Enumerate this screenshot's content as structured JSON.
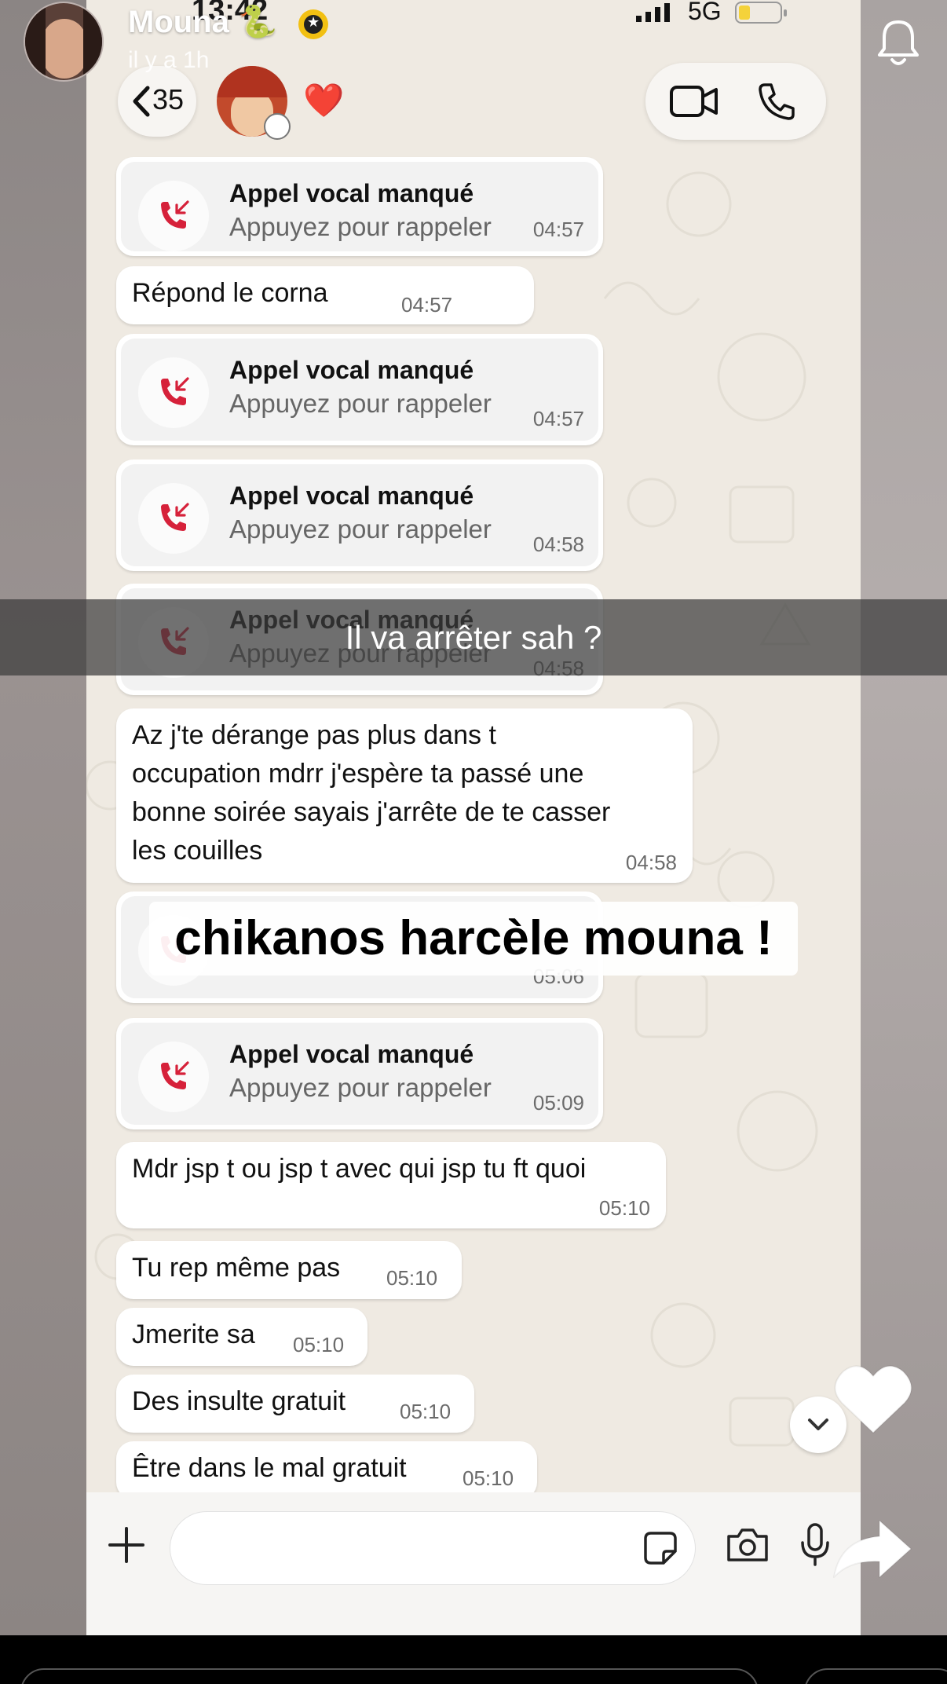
{
  "status_bar": {
    "time": "13:42",
    "network": "5G"
  },
  "story": {
    "user_name": "Mouna",
    "name_emoji": "🐍",
    "time_ago": "il y a 1h"
  },
  "chat_header": {
    "back_count": "35",
    "reaction_emoji": "❤️"
  },
  "messages": [
    {
      "type": "call",
      "title": "Appel vocal manqué",
      "subtitle": "Appuyez pour rappeler",
      "time": "04:57"
    },
    {
      "type": "text",
      "lines": [
        "Répond le corna"
      ],
      "time": "04:57"
    },
    {
      "type": "call",
      "title": "Appel vocal manqué",
      "subtitle": "Appuyez pour rappeler",
      "time": "04:57"
    },
    {
      "type": "call",
      "title": "Appel vocal manqué",
      "subtitle": "Appuyez pour rappeler",
      "time": "04:58"
    },
    {
      "type": "call",
      "title": "Appel vocal manqué",
      "subtitle": "Appuyez pour rappeler",
      "time": "04:58"
    },
    {
      "type": "text",
      "lines": [
        "Az j'te dérange pas plus dans t",
        "occupation mdrr j'espère ta passé une",
        "bonne soirée sayais j'arrête de te casser",
        "les couilles"
      ],
      "time": "04:58"
    },
    {
      "type": "call",
      "title": "",
      "subtitle": "",
      "time": "05:06"
    },
    {
      "type": "call",
      "title": "Appel vocal manqué",
      "subtitle": "Appuyez pour rappeler",
      "time": "05:09"
    },
    {
      "type": "text",
      "lines": [
        "Mdr jsp t ou jsp t avec qui jsp tu ft quoi"
      ],
      "time": "05:10"
    },
    {
      "type": "text",
      "lines": [
        "Tu rep même pas"
      ],
      "time": "05:10"
    },
    {
      "type": "text",
      "lines": [
        "Jmerite sa"
      ],
      "time": "05:10"
    },
    {
      "type": "text",
      "lines": [
        "Des insulte gratuit"
      ],
      "time": "05:10"
    },
    {
      "type": "text",
      "lines": [
        "Être dans le mal gratuit"
      ],
      "time": "05:10"
    }
  ],
  "overlays": {
    "caption_text": "Il va arrêter sah ?",
    "title_text": "chikanos harcèle mouna !"
  },
  "icons": {
    "notification": "bell-icon",
    "video_call": "video-camera-icon",
    "voice_call": "phone-icon",
    "add": "plus-icon",
    "sticker": "sticker-icon",
    "camera": "camera-icon",
    "microphone": "microphone-icon",
    "scroll_down": "chevron-down-icon",
    "like": "heart-icon",
    "share": "share-arrow-icon",
    "missed_call": "missed-call-icon"
  },
  "colors": {
    "chat_bg": "#efeae2",
    "bubble": "#ffffff",
    "missed_call_red": "#d6213a",
    "caption_bar": "#3c3c3c"
  }
}
